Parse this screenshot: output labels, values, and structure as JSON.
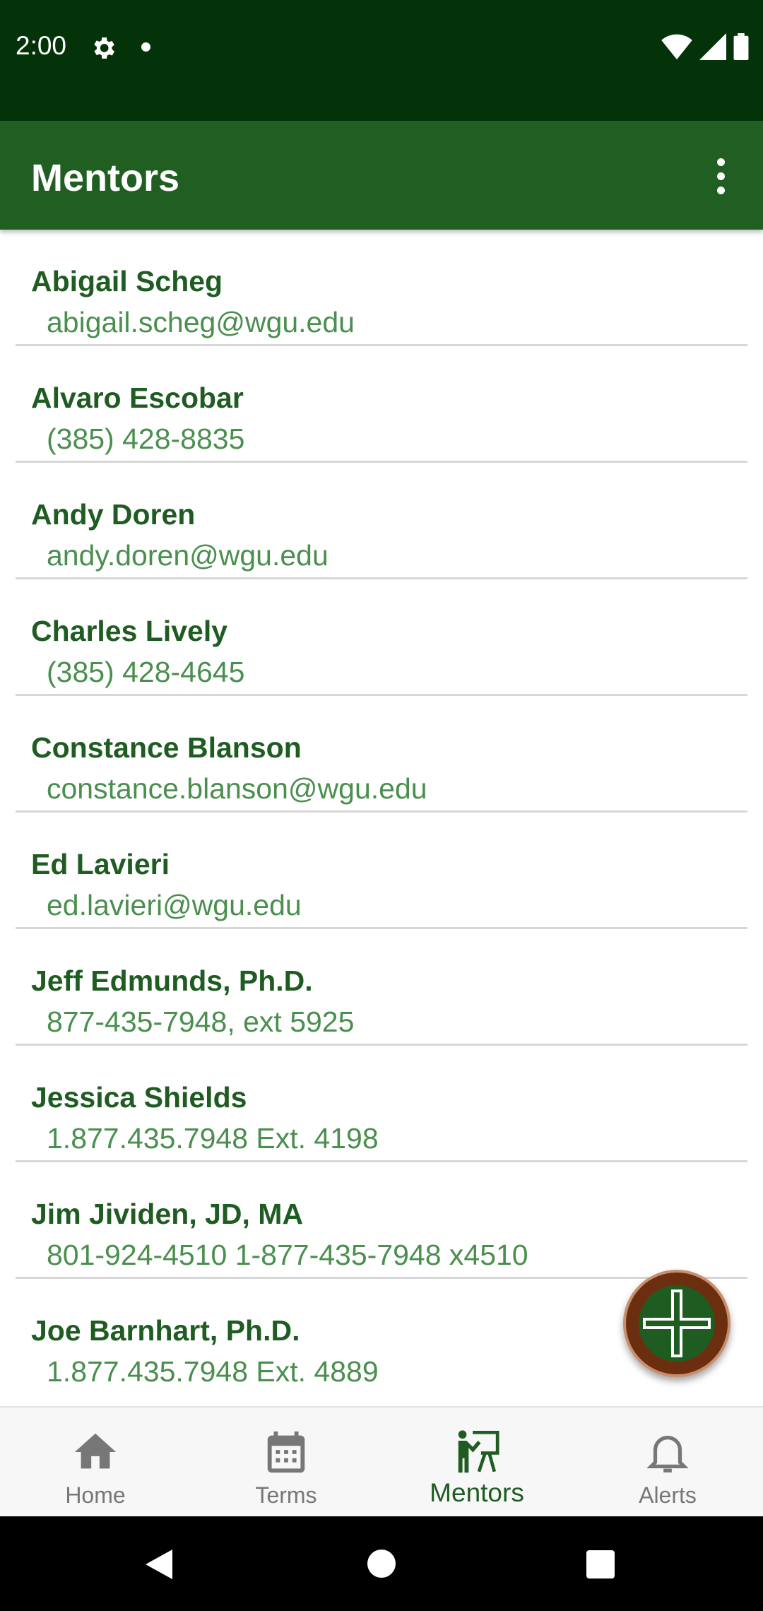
{
  "status_bar": {
    "time": "2:00"
  },
  "app_bar": {
    "title": "Mentors"
  },
  "mentors": [
    {
      "name": "Abigail Scheg",
      "contact": "abigail.scheg@wgu.edu"
    },
    {
      "name": "Alvaro Escobar",
      "contact": "(385) 428-8835"
    },
    {
      "name": "Andy Doren",
      "contact": "andy.doren@wgu.edu"
    },
    {
      "name": "Charles Lively",
      "contact": "(385) 428-4645"
    },
    {
      "name": "Constance Blanson",
      "contact": "constance.blanson@wgu.edu"
    },
    {
      "name": "Ed Lavieri",
      "contact": "ed.lavieri@wgu.edu"
    },
    {
      "name": "Jeff Edmunds, Ph.D.",
      "contact": "877-435-7948, ext 5925"
    },
    {
      "name": "Jessica Shields",
      "contact": "1.877.435.7948 Ext. 4198"
    },
    {
      "name": "Jim Jividen, JD, MA",
      "contact": "801-924-4510 1-877-435-7948 x4510"
    },
    {
      "name": "Joe Barnhart, Ph.D.",
      "contact": "1.877.435.7948 Ext. 4889"
    }
  ],
  "bottom_nav": [
    {
      "label": "Home",
      "icon": "home-icon"
    },
    {
      "label": "Terms",
      "icon": "calendar-icon"
    },
    {
      "label": "Mentors",
      "icon": "mentor-icon",
      "active": true
    },
    {
      "label": "Alerts",
      "icon": "bell-icon"
    }
  ],
  "colors": {
    "status_bar": "#04330a",
    "app_bar": "#205e22",
    "name_text": "#1f5c22",
    "contact_text": "#4a8f4e",
    "fab": "#6b2f10"
  }
}
